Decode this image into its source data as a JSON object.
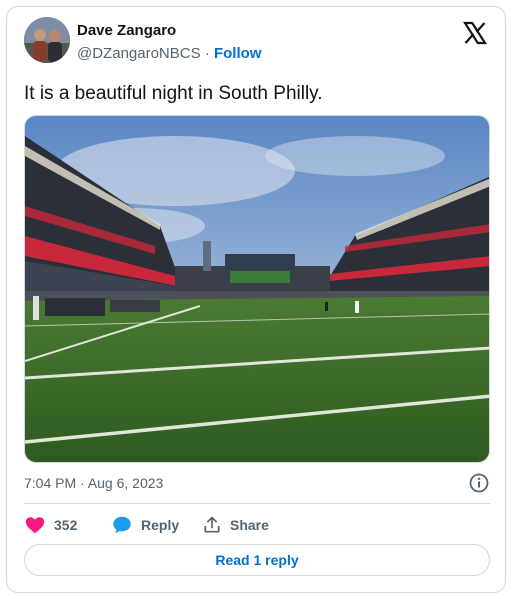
{
  "author": {
    "name": "Dave Zangaro",
    "handle": "@DZangaroNBCS",
    "separator": "·",
    "follow_label": "Follow"
  },
  "tweet": {
    "text": "It is a beautiful night in South Philly.",
    "timestamp": "7:04 PM · Aug 6, 2023"
  },
  "actions": {
    "like_count": "352",
    "reply_label": "Reply",
    "share_label": "Share",
    "read_replies_label": "Read 1 reply"
  },
  "icons": {
    "brand": "x-logo-icon",
    "info": "info-icon",
    "like": "heart-icon",
    "reply": "speech-bubble-icon",
    "share": "share-arrow-icon"
  },
  "colors": {
    "link": "#006fd6",
    "like": "#f91880",
    "reply": "#1d9bf0",
    "muted": "#536471",
    "border": "#cfd9de"
  }
}
